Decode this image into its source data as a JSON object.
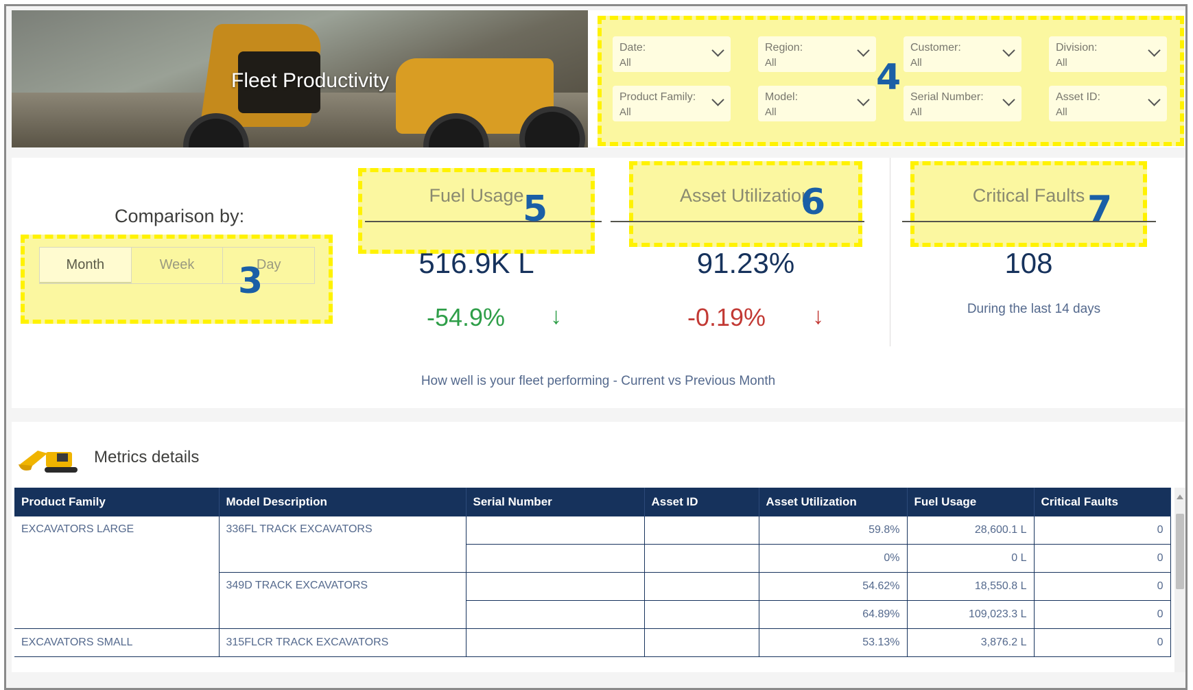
{
  "header": {
    "title": "Fleet Productivity"
  },
  "filters": [
    {
      "label": "Date:",
      "value": "All"
    },
    {
      "label": "Region:",
      "value": "All"
    },
    {
      "label": "Customer:",
      "value": "All"
    },
    {
      "label": "Division:",
      "value": "All"
    },
    {
      "label": "Product Family:",
      "value": "All"
    },
    {
      "label": "Model:",
      "value": "All"
    },
    {
      "label": "Serial Number:",
      "value": "All"
    },
    {
      "label": "Asset ID:",
      "value": "All"
    }
  ],
  "annotations": {
    "comparison": "3",
    "filters": "4",
    "fuel": "5",
    "utilization": "6",
    "faults": "7"
  },
  "comparison": {
    "label": "Comparison by:",
    "options": [
      "Month",
      "Week",
      "Day"
    ],
    "selected": "Month"
  },
  "kpis": {
    "fuel": {
      "title": "Fuel Usage",
      "value": "516.9K L",
      "delta": "-54.9%",
      "delta_color": "#2e9e48",
      "arrow": "↓"
    },
    "utilization": {
      "title": "Asset Utilization",
      "value": "91.23%",
      "delta": "-0.19%",
      "delta_color": "#c23934",
      "arrow": "↓"
    },
    "faults": {
      "title": "Critical Faults",
      "value": "108",
      "note": "During the last 14 days"
    }
  },
  "kpi_subtitle": "How well is your fleet performing - Current vs Previous Month",
  "metrics": {
    "title": "Metrics details",
    "columns": [
      "Product Family",
      "Model Description",
      "Serial Number",
      "Asset ID",
      "Asset Utilization",
      "Fuel Usage",
      "Critical Faults"
    ],
    "rows": [
      {
        "family": "EXCAVATORS LARGE",
        "model": "336FL TRACK EXCAVATORS",
        "serial": "",
        "asset": "",
        "util": "59.8%",
        "fuel": "28,600.1 L",
        "faults": "0"
      },
      {
        "family": "",
        "model": "",
        "serial": "",
        "asset": "",
        "util": "0%",
        "fuel": "0 L",
        "faults": "0"
      },
      {
        "family": "",
        "model": "349D TRACK EXCAVATORS",
        "serial": "",
        "asset": "",
        "util": "54.62%",
        "fuel": "18,550.8 L",
        "faults": "0"
      },
      {
        "family": "",
        "model": "",
        "serial": "",
        "asset": "",
        "util": "64.89%",
        "fuel": "109,023.3 L",
        "faults": "0"
      },
      {
        "family": "EXCAVATORS SMALL",
        "model": "315FLCR TRACK EXCAVATORS",
        "serial": "",
        "asset": "",
        "util": "53.13%",
        "fuel": "3,876.2 L",
        "faults": "0"
      }
    ]
  }
}
